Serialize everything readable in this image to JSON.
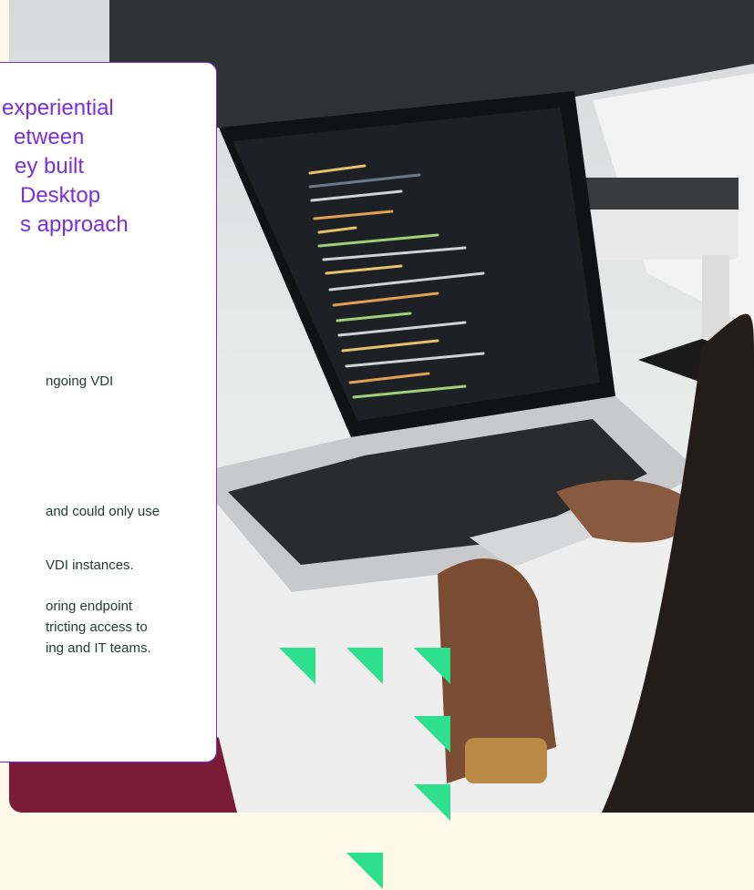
{
  "card": {
    "heading_lines": [
      "experiential",
      "etween",
      "ey built",
      "Desktop",
      "s approach"
    ],
    "body_lines": [
      "ngoing VDI",
      "and could only use",
      "VDI instances.",
      "oring endpoint",
      "tricting access to",
      "ing and IT teams."
    ]
  },
  "photo": {
    "subject": "laptop-with-code-editor"
  },
  "colors": {
    "accent_purple": "#7a2ee0",
    "body_text": "#1f3a32",
    "triangle_green": "#2ee08e",
    "page_background": "#fdf8e8"
  }
}
